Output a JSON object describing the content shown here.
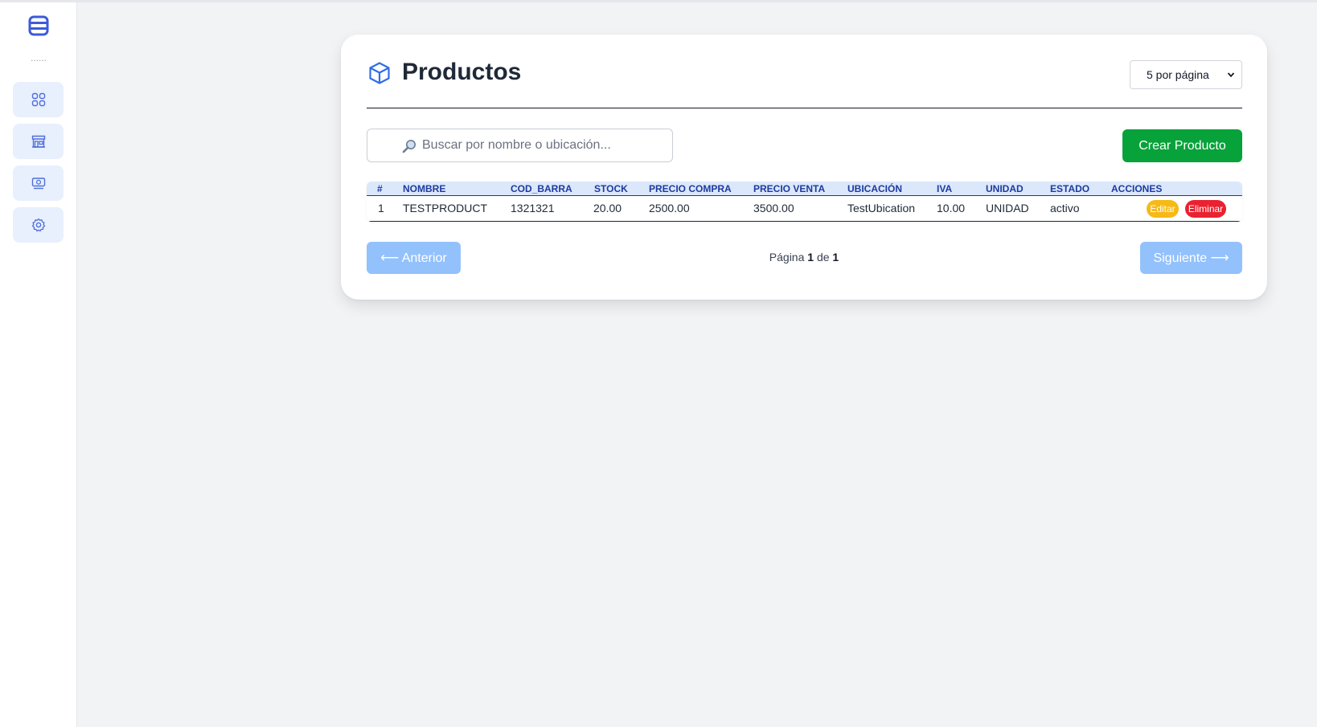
{
  "sidebar": {
    "dots": "......",
    "items": [
      {
        "icon": "grid-icon"
      },
      {
        "icon": "store-icon"
      },
      {
        "icon": "cash-icon"
      },
      {
        "icon": "gear-icon"
      }
    ]
  },
  "header": {
    "title": "Productos",
    "per_page": "5 por página"
  },
  "search": {
    "placeholder": "Buscar por nombre o ubicación..."
  },
  "toolbar": {
    "create_label": "Crear Producto"
  },
  "table": {
    "columns": [
      "#",
      "NOMBRE",
      "COD_BARRA",
      "STOCK",
      "PRECIO COMPRA",
      "PRECIO VENTA",
      "UBICACIÓN",
      "IVA",
      "UNIDAD",
      "ESTADO",
      "ACCIONES"
    ],
    "rows": [
      {
        "num": "1",
        "nombre": "TESTPRODUCT",
        "cod_barra": "1321321",
        "stock": "20.00",
        "precio_compra": "2500.00",
        "precio_venta": "3500.00",
        "ubicacion": "TestUbication",
        "iva": "10.00",
        "unidad": "UNIDAD",
        "estado": "activo",
        "edit_label": "Editar",
        "delete_label": "Eliminar"
      }
    ]
  },
  "pagination": {
    "prev_label": "⟵ Anterior",
    "next_label": "Siguiente ⟶",
    "page_prefix": "Página",
    "current": "1",
    "of_word": "de",
    "total": "1"
  },
  "colors": {
    "accent": "#3b5bdb",
    "create": "#07a23a",
    "edit": "#f6b916",
    "delete": "#ea2130",
    "pager_button": "#93c1fc"
  }
}
